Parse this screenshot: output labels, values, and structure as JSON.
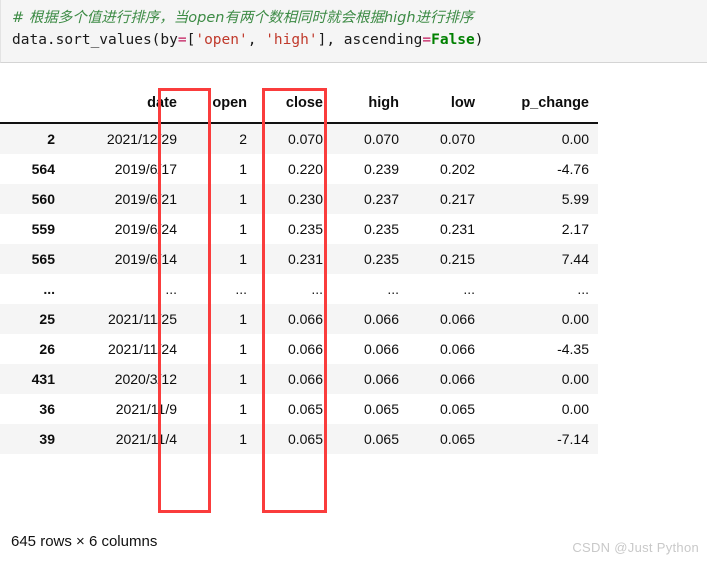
{
  "code_cell": {
    "comment": "# 根据多个值进行排序，当open有两个数相同时就会根据high进行排序",
    "statement_parts": {
      "p1": "data.sort_values(by",
      "op1": "=",
      "b1": "[",
      "s1": "'open'",
      "comma1": ", ",
      "s2": "'high'",
      "b2": "]",
      "comma2": ", ",
      "p2": "ascending",
      "op2": "=",
      "kw": "False",
      "p3": ")"
    },
    "statement_plain": "data.sort_values(by=['open', 'high'], ascending=False)",
    "colors": {
      "comment": "#3d8b45",
      "string": "#c0392b",
      "operator": "#c2185b",
      "keyword": "#008000",
      "background": "#f5f5f5"
    }
  },
  "dataframe": {
    "columns": [
      "date",
      "open",
      "close",
      "high",
      "low",
      "p_change"
    ],
    "index_header": "",
    "rows": [
      {
        "index": "2",
        "date": "2021/12/29",
        "open": "2",
        "close": "0.070",
        "high": "0.070",
        "low": "0.070",
        "p_change": "0.00"
      },
      {
        "index": "564",
        "date": "2019/6/17",
        "open": "1",
        "close": "0.220",
        "high": "0.239",
        "low": "0.202",
        "p_change": "-4.76"
      },
      {
        "index": "560",
        "date": "2019/6/21",
        "open": "1",
        "close": "0.230",
        "high": "0.237",
        "low": "0.217",
        "p_change": "5.99"
      },
      {
        "index": "559",
        "date": "2019/6/24",
        "open": "1",
        "close": "0.235",
        "high": "0.235",
        "low": "0.231",
        "p_change": "2.17"
      },
      {
        "index": "565",
        "date": "2019/6/14",
        "open": "1",
        "close": "0.231",
        "high": "0.235",
        "low": "0.215",
        "p_change": "7.44"
      },
      {
        "index": "...",
        "date": "...",
        "open": "...",
        "close": "...",
        "high": "...",
        "low": "...",
        "p_change": "..."
      },
      {
        "index": "25",
        "date": "2021/11/25",
        "open": "1",
        "close": "0.066",
        "high": "0.066",
        "low": "0.066",
        "p_change": "0.00"
      },
      {
        "index": "26",
        "date": "2021/11/24",
        "open": "1",
        "close": "0.066",
        "high": "0.066",
        "low": "0.066",
        "p_change": "-4.35"
      },
      {
        "index": "431",
        "date": "2020/3/12",
        "open": "1",
        "close": "0.066",
        "high": "0.066",
        "low": "0.066",
        "p_change": "0.00"
      },
      {
        "index": "36",
        "date": "2021/11/9",
        "open": "1",
        "close": "0.065",
        "high": "0.065",
        "low": "0.065",
        "p_change": "0.00"
      },
      {
        "index": "39",
        "date": "2021/11/4",
        "open": "1",
        "close": "0.065",
        "high": "0.065",
        "low": "0.065",
        "p_change": "-7.14"
      }
    ],
    "shape_text": "645 rows × 6 columns",
    "row_count": 645,
    "column_count": 6
  },
  "annotations": {
    "highlight_color": "#fa3c3c",
    "boxes": [
      {
        "label": "open-column-highlight",
        "column": "open"
      },
      {
        "label": "high-column-highlight",
        "column": "high"
      }
    ]
  },
  "watermark": {
    "text": "CSDN @Just Python"
  }
}
